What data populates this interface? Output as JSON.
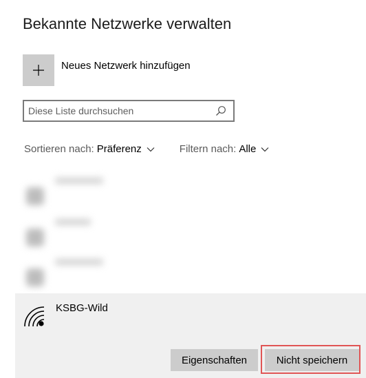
{
  "page": {
    "title": "Bekannte Netzwerke verwalten"
  },
  "add_network": {
    "label": "Neues Netzwerk hinzufügen",
    "icon": "plus-icon"
  },
  "search": {
    "placeholder": "Diese Liste durchsuchen",
    "value": "",
    "icon": "search-icon"
  },
  "sort": {
    "label": "Sortieren nach:",
    "value": "Präferenz"
  },
  "filter": {
    "label": "Filtern nach:",
    "value": "Alle"
  },
  "blurred_networks": [
    {
      "name": ""
    },
    {
      "name": ""
    },
    {
      "name": ""
    }
  ],
  "selected_network": {
    "name": "KSBG-Wild",
    "icon": "wifi-icon",
    "buttons": {
      "properties": "Eigenschaften",
      "forget": "Nicht speichern"
    }
  },
  "colors": {
    "tile_gray": "#cccccc",
    "selected_bg": "#f0f0f0",
    "highlight": "#e05555"
  }
}
